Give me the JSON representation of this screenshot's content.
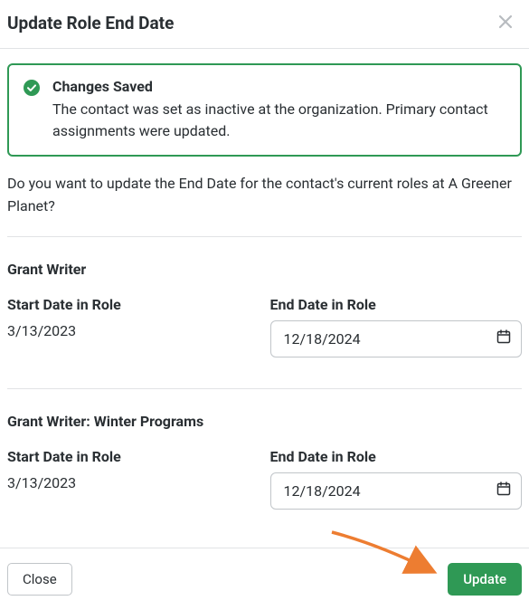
{
  "header": {
    "title": "Update Role End Date"
  },
  "alert": {
    "title": "Changes Saved",
    "message": "The contact was set as inactive at the organization. Primary contact assignments were updated."
  },
  "prompt": "Do you want to update the End Date for the contact's current roles at A Greener Planet?",
  "labels": {
    "start_date": "Start Date in Role",
    "end_date": "End Date in Role"
  },
  "roles": [
    {
      "name": "Grant Writer",
      "start_date": "3/13/2023",
      "end_date": "12/18/2024"
    },
    {
      "name": "Grant Writer: Winter Programs",
      "start_date": "3/13/2023",
      "end_date": "12/18/2024"
    }
  ],
  "footer": {
    "close_label": "Close",
    "update_label": "Update"
  },
  "colors": {
    "accent_green": "#2f9955",
    "arrow_orange": "#ed7d31"
  }
}
